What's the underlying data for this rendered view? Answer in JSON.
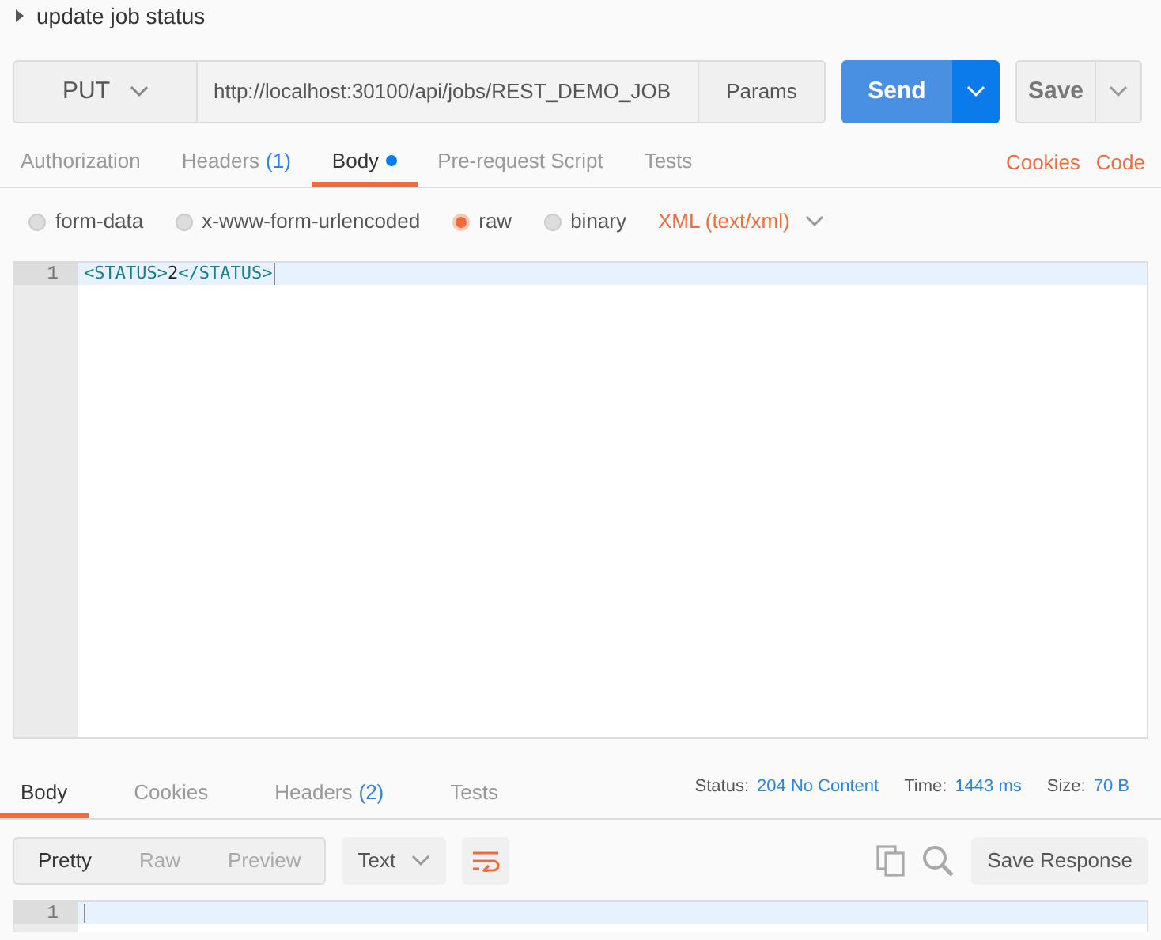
{
  "request_name": "update job status",
  "request": {
    "method": "PUT",
    "url": "http://localhost:30100/api/jobs/REST_DEMO_JOB",
    "params_button": "Params",
    "send_button": "Send",
    "save_button": "Save"
  },
  "request_tabs": [
    {
      "label": "Authorization",
      "selected": false
    },
    {
      "label": "Headers",
      "count": "(1)",
      "selected": false
    },
    {
      "label": "Body",
      "selected": true,
      "dot": true
    },
    {
      "label": "Pre-request Script",
      "selected": false
    },
    {
      "label": "Tests",
      "selected": false
    }
  ],
  "request_links": [
    "Cookies",
    "Code"
  ],
  "body_modes": [
    {
      "label": "form-data",
      "selected": false
    },
    {
      "label": "x-www-form-urlencoded",
      "selected": false
    },
    {
      "label": "raw",
      "selected": true
    },
    {
      "label": "binary",
      "selected": false
    }
  ],
  "body_format": "XML (text/xml)",
  "editor": {
    "lines": [
      {
        "number": "1",
        "tokens": [
          {
            "kind": "tag",
            "text": "<STATUS>"
          },
          {
            "kind": "text",
            "text": "2"
          },
          {
            "kind": "tag",
            "text": "</STATUS>"
          }
        ]
      }
    ]
  },
  "response_tabs": [
    {
      "label": "Body",
      "selected": true
    },
    {
      "label": "Cookies",
      "selected": false
    },
    {
      "label": "Headers",
      "count": "(2)",
      "selected": false
    },
    {
      "label": "Tests",
      "selected": false
    }
  ],
  "response_meta": [
    {
      "label": "Status:",
      "value": "204 No Content"
    },
    {
      "label": "Time:",
      "value": "1443 ms"
    },
    {
      "label": "Size:",
      "value": "70 B"
    }
  ],
  "response_view": {
    "modes": [
      {
        "label": "Pretty",
        "selected": true
      },
      {
        "label": "Raw",
        "selected": false
      },
      {
        "label": "Preview",
        "selected": false
      }
    ],
    "format": "Text",
    "save_button": "Save Response"
  },
  "response_editor": {
    "lines": [
      {
        "number": "1"
      }
    ]
  }
}
